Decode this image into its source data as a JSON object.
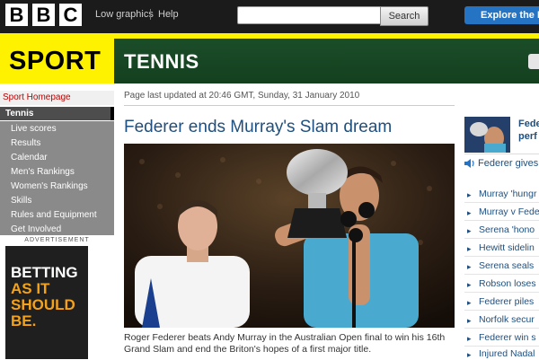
{
  "header": {
    "bbc_letters": [
      "B",
      "B",
      "C"
    ],
    "low_graphics": "Low graphics",
    "help": "Help",
    "search": {
      "value": "",
      "placeholder": "",
      "button_label": "Search"
    },
    "explore_label": "Explore the B"
  },
  "banner": {
    "sport": "SPORT",
    "section": "TENNIS"
  },
  "nav": {
    "home": "Sport Homepage",
    "current": "Tennis",
    "items": [
      "Live scores",
      "Results",
      "Calendar",
      "Men's Rankings",
      "Women's Rankings",
      "Skills",
      "Rules and Equipment",
      "Get Involved"
    ]
  },
  "advert": {
    "label": "ADVERTISEMENT",
    "lines": [
      "BETTING",
      "AS IT",
      "SHOULD",
      "BE."
    ]
  },
  "article": {
    "updated": "Page last updated at 20:46 GMT, Sunday, 31 January 2010",
    "headline": "Federer ends Murray's Slam dream",
    "caption": "Roger Federer beats Andy Murray in the Australian Open final to win his 16th Grand Slam and end the Briton's hopes of a first major title."
  },
  "side": {
    "headline_lines": [
      "Fede",
      "perf"
    ],
    "audio": "Federer gives",
    "stories": [
      "Murray 'hungr",
      "Murray v Fede",
      "Serena 'hono",
      "Hewitt sidelin",
      "Serena seals",
      "Robson loses",
      "Federer piles",
      "Norfolk secur",
      "Federer win s",
      "Injured Nadal"
    ]
  },
  "colors": {
    "top_bar": "#1b1b1b",
    "sport_yellow": "#fff200",
    "tennis_green": "#1b4d29",
    "link_blue": "#1f4f7f",
    "nav_grey": "#8a8a8a",
    "nav_active": "#4d4d4d",
    "explore_blue": "#2574c4"
  },
  "icons": {
    "audio": "speaker-icon",
    "story_bullet": "chevron-right-icon"
  }
}
